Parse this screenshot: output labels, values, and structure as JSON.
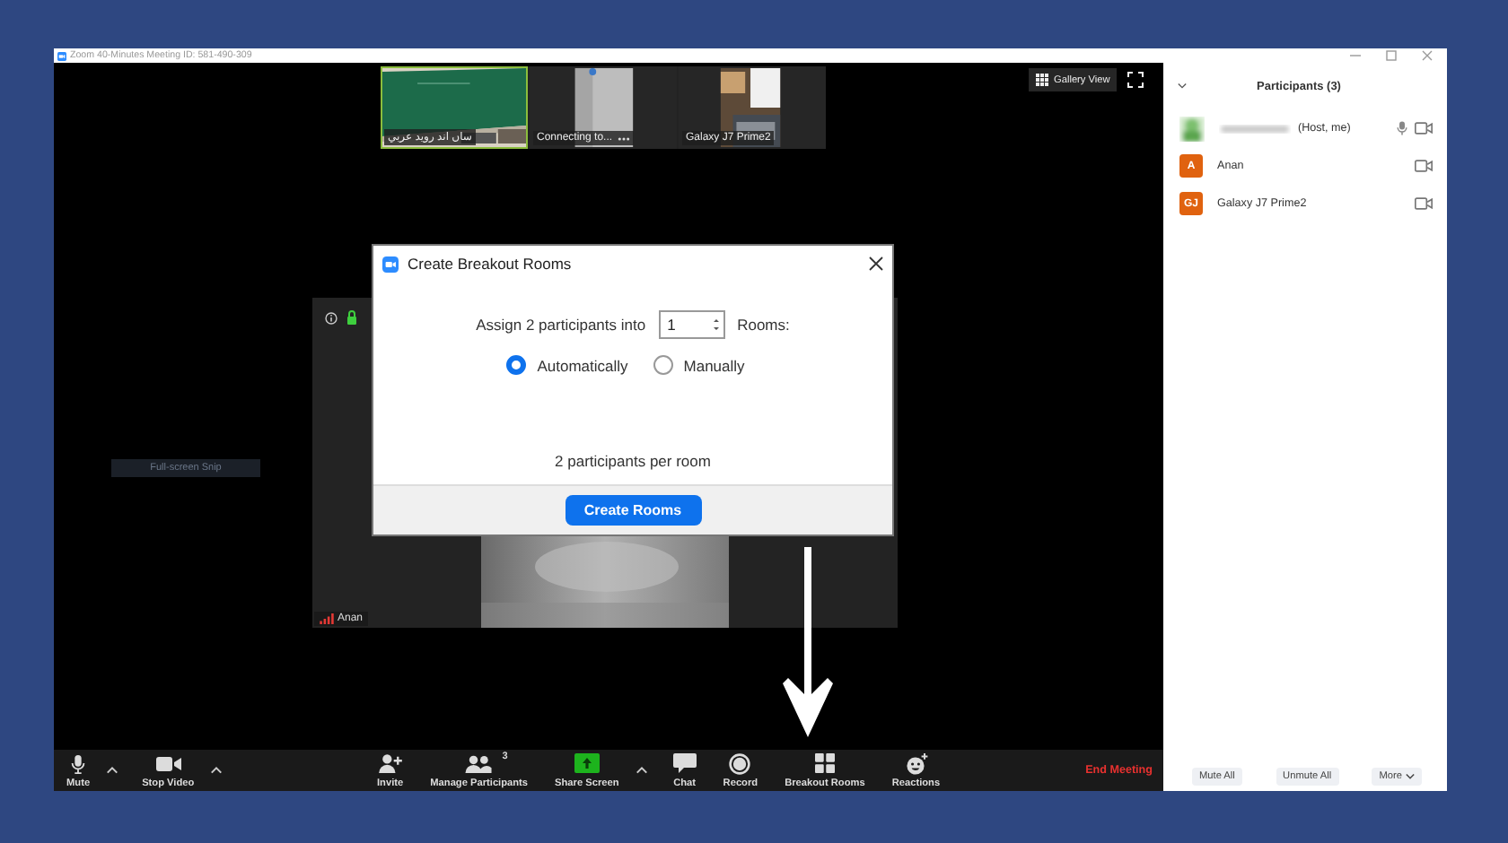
{
  "window": {
    "title": "Zoom 40-Minutes Meeting ID: 581-490-309"
  },
  "thumbnails": [
    {
      "label": "ساں اند روید عربي",
      "menu": false,
      "highlighted": true
    },
    {
      "label": "Connecting to...",
      "menu": true,
      "highlighted": false
    },
    {
      "label": "Galaxy J7 Prime2",
      "menu": false,
      "highlighted": false
    }
  ],
  "gallery_view": {
    "label": "Gallery View"
  },
  "snip_label": "Full-screen Snip",
  "speaker": {
    "name": "Anan"
  },
  "dialog": {
    "title": "Create Breakout Rooms",
    "assign_text": "Assign 2 participants into",
    "rooms_value": "1",
    "rooms_text": "Rooms:",
    "options": [
      {
        "label": "Automatically",
        "selected": true
      },
      {
        "label": "Manually",
        "selected": false
      }
    ],
    "summary": "2 participants per room",
    "button": "Create Rooms"
  },
  "toolbar": {
    "items": [
      {
        "kind": "mute",
        "label": "Mute",
        "menu": true
      },
      {
        "kind": "video",
        "label": "Stop Video",
        "menu": true
      },
      {
        "kind": "invite",
        "label": "Invite",
        "menu": false
      },
      {
        "kind": "participants",
        "label": "Manage Participants",
        "badge": "3",
        "menu": false
      },
      {
        "kind": "share",
        "label": "Share Screen",
        "menu": true
      },
      {
        "kind": "chat",
        "label": "Chat",
        "menu": false
      },
      {
        "kind": "record",
        "label": "Record",
        "menu": false
      },
      {
        "kind": "breakout",
        "label": "Breakout Rooms",
        "menu": false
      },
      {
        "kind": "reactions",
        "label": "Reactions",
        "menu": false
      }
    ],
    "end_button": "End Meeting"
  },
  "participants": {
    "title": "Participants (3)",
    "list": [
      {
        "name": "(Host, me)",
        "audio": true
      },
      {
        "initials": "A",
        "name": "Anan",
        "audio": false
      },
      {
        "initials": "GJ",
        "name": "Galaxy J7 Prime2",
        "audio": false
      }
    ],
    "buttons": [
      {
        "label": "Mute All",
        "menu": false
      },
      {
        "label": "Unmute All",
        "menu": false
      },
      {
        "label": "More",
        "menu": true
      }
    ]
  }
}
